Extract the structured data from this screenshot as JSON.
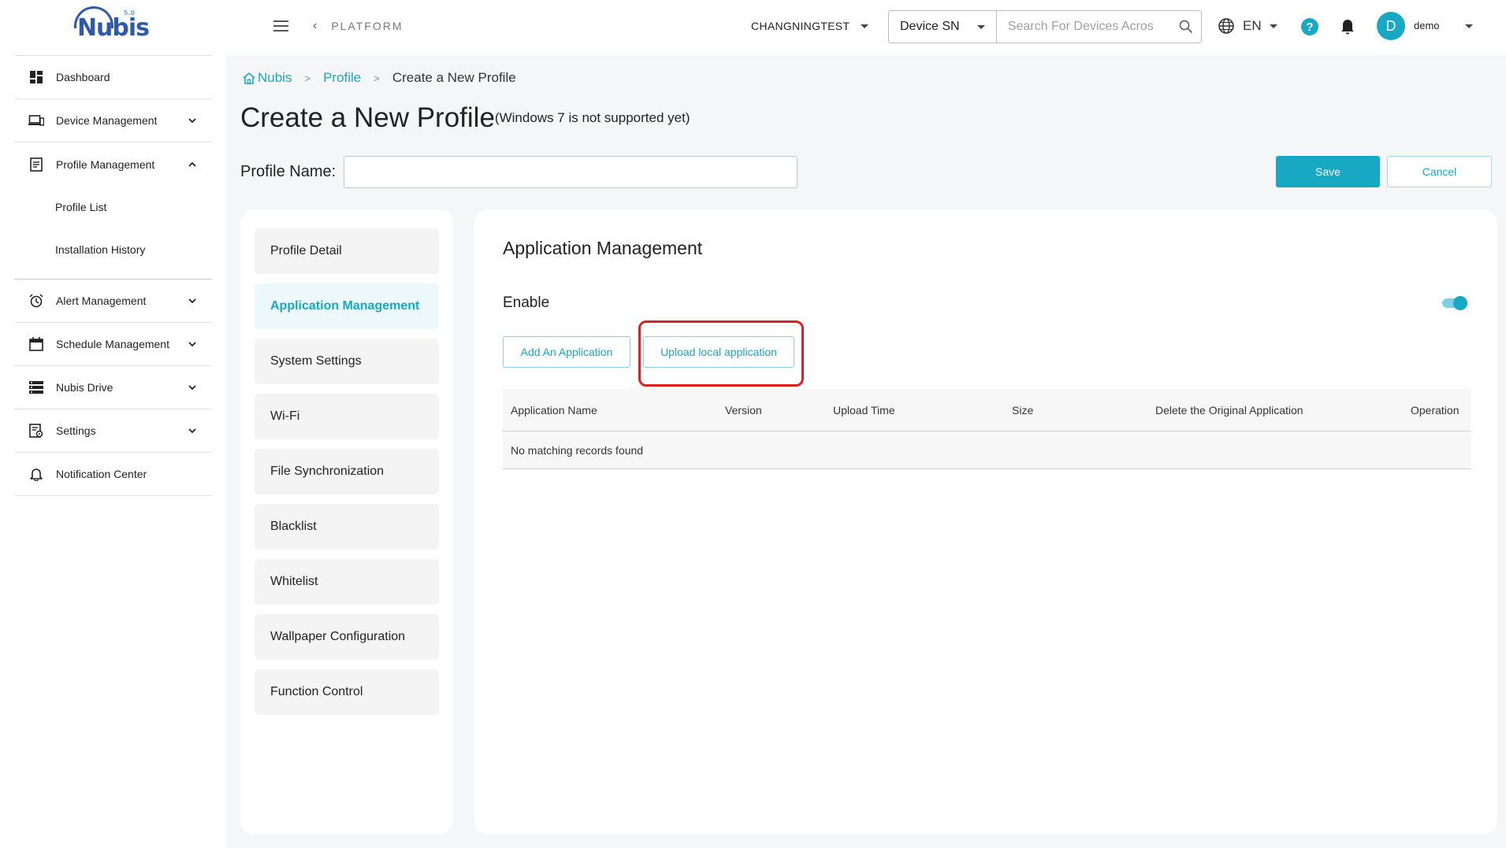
{
  "logo": {
    "text": "Nubis",
    "sup": "5.0"
  },
  "sidebar": {
    "items": [
      {
        "label": "Dashboard"
      },
      {
        "label": "Device Management"
      },
      {
        "label": "Profile Management"
      },
      {
        "label": "Profile List"
      },
      {
        "label": "Installation History"
      },
      {
        "label": "Alert Management"
      },
      {
        "label": "Schedule Management"
      },
      {
        "label": "Nubis Drive"
      },
      {
        "label": "Settings"
      },
      {
        "label": "Notification Center"
      }
    ]
  },
  "header": {
    "back_label": "PLATFORM",
    "tenant": "CHANGNINGTEST",
    "search_type": "Device SN",
    "search_placeholder": "Search For Devices Acros",
    "language": "EN",
    "avatar_initial": "D",
    "username": "demo"
  },
  "breadcrumb": {
    "home": "Nubis",
    "profile": "Profile",
    "current": "Create a New Profile"
  },
  "page": {
    "title": "Create a New Profile",
    "note": "(Windows 7 is not supported yet)",
    "profile_name_label": "Profile Name:",
    "profile_name_value": "",
    "save_label": "Save",
    "cancel_label": "Cancel"
  },
  "tabs": [
    {
      "label": "Profile Detail"
    },
    {
      "label": "Application Management"
    },
    {
      "label": "System Settings"
    },
    {
      "label": "Wi-Fi"
    },
    {
      "label": "File Synchronization"
    },
    {
      "label": "Blacklist"
    },
    {
      "label": "Whitelist"
    },
    {
      "label": "Wallpaper Configuration"
    },
    {
      "label": "Function Control"
    }
  ],
  "app_mgmt": {
    "title": "Application Management",
    "enable_label": "Enable",
    "enabled": true,
    "add_label": "Add An Application",
    "upload_label": "Upload local application",
    "columns": [
      "Application Name",
      "Version",
      "Upload Time",
      "Size",
      "Delete the Original Application",
      "Operation"
    ],
    "empty_text": "No matching records found"
  },
  "colors": {
    "accent": "#17a8c4",
    "highlight": "#e02020",
    "brand": "#2e5aa8"
  }
}
